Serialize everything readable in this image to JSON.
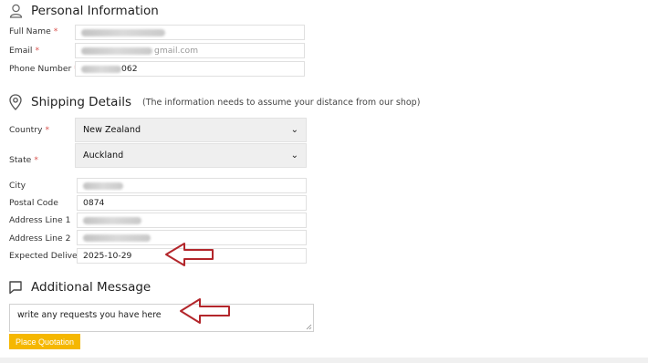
{
  "personal": {
    "title": "Personal Information",
    "icon": "user-icon",
    "full_name": {
      "label": "Full Name",
      "value_suffix": ""
    },
    "email": {
      "label": "Email",
      "value_suffix": "gmail.com"
    },
    "phone": {
      "label": "Phone Number",
      "value_suffix": "062"
    }
  },
  "shipping": {
    "title": "Shipping Details",
    "note": "(The information needs to assume your distance from our shop)",
    "icon": "map-pin-icon",
    "country": {
      "label": "Country",
      "value": "New Zealand"
    },
    "state": {
      "label": "State",
      "value": "Auckland"
    },
    "city": {
      "label": "City"
    },
    "postal": {
      "label": "Postal Code",
      "value": "0874"
    },
    "address1": {
      "label": "Address Line 1"
    },
    "address2": {
      "label": "Address Line 2"
    },
    "delivery": {
      "label": "Expected Delivery",
      "value": "2025-10-29"
    }
  },
  "message": {
    "title": "Additional Message",
    "icon": "chat-icon",
    "placeholder": "write any requests you have here"
  },
  "submit_label": "Place Quotation",
  "required_mark": "*",
  "colors": {
    "accent": "#f5b700",
    "required": "#d9534f",
    "arrow": "#b3262b"
  }
}
